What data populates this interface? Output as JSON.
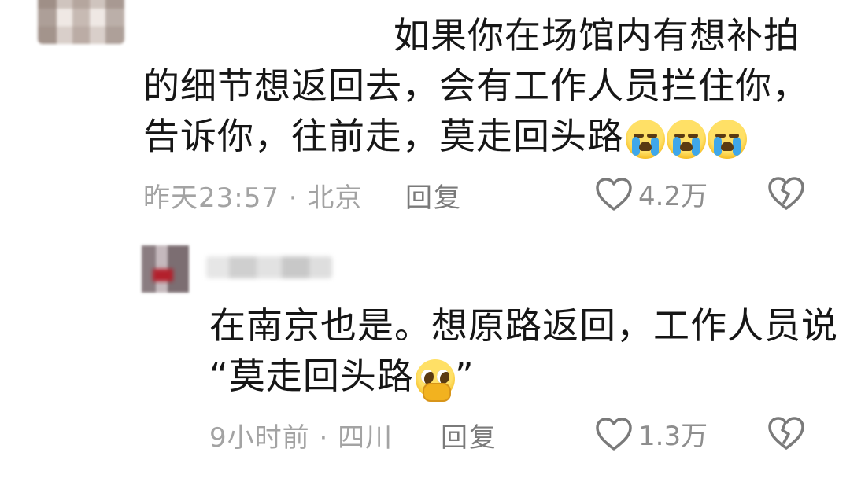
{
  "comment": {
    "text_lines": [
      "如果你在场馆内有想补拍",
      "的细节想返回去，会有工作人员拦住你，",
      "告诉你，往前走，莫走回头路"
    ],
    "emojis": [
      "crying-face",
      "crying-face",
      "crying-face"
    ],
    "time": "昨天23:57",
    "separator": "·",
    "location": "北京",
    "reply_label": "回复",
    "like_count": "4.2万"
  },
  "reply": {
    "text_lines": [
      "在南京也是。想原路返回，工作人员说",
      "“莫走回头路",
      "”"
    ],
    "emoji": "pleading-face-hands",
    "time": "9小时前",
    "separator": "·",
    "location": "四川",
    "reply_label": "回复",
    "like_count": "1.3万"
  },
  "colors": {
    "text": "#161616",
    "meta": "#a3a3a3",
    "reply_label": "#7a7a7a",
    "icon_stroke": "#7a7a7a"
  }
}
